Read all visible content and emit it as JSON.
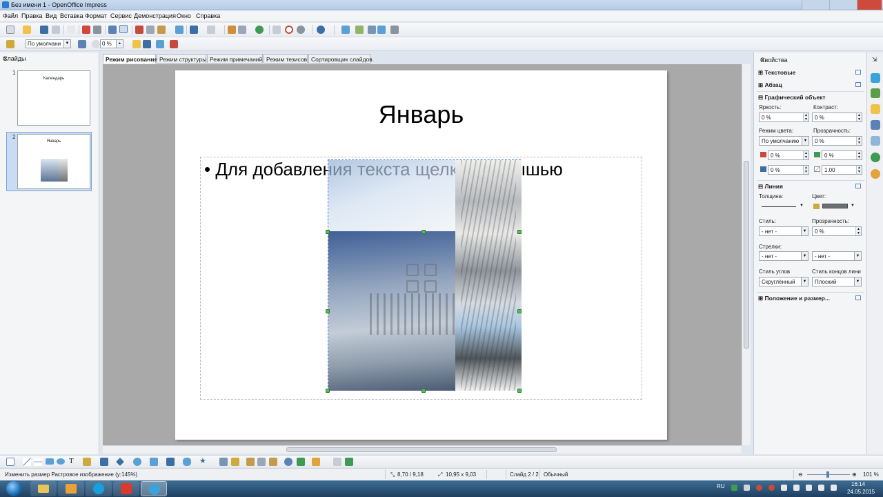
{
  "window": {
    "title": "Без имени 1 - OpenOffice Impress"
  },
  "menu": [
    "Файл",
    "Правка",
    "Вид",
    "Вставка",
    "Формат",
    "Сервис",
    "Демонстрация",
    "Окно",
    "Справка"
  ],
  "toolbar2": {
    "style_select": "По умолчани",
    "rotation_value": "0 %"
  },
  "slides_pane": {
    "title": "Слайды",
    "slides": [
      {
        "number": "1",
        "title": "Календарь"
      },
      {
        "number": "2",
        "title": "Январь"
      }
    ]
  },
  "view_tabs": [
    "Режим рисования",
    "Режим структуры",
    "Режим примечаний",
    "Режим тезисов",
    "Сортировщик слайдов"
  ],
  "slide": {
    "title": "Январь",
    "content_placeholder": "• Для добавления текста щелкните мышью"
  },
  "sidebar": {
    "title": "Свойства",
    "sections": {
      "text": "Текстовые",
      "paragraph": "Абзац",
      "graphic": "Графический объект",
      "line": "Линия",
      "position": "Положение и размер..."
    },
    "graphic": {
      "brightness_label": "Яркость:",
      "brightness": "0 %",
      "contrast_label": "Контраст:",
      "contrast": "0 %",
      "color_mode_label": "Режим цвета:",
      "color_mode": "По умолчанию",
      "transparency_label": "Прозрачность:",
      "transparency": "0 %",
      "red": "0 %",
      "green": "0 %",
      "blue": "0 %",
      "gamma": "1,00"
    },
    "line": {
      "width_label": "Толщина:",
      "color_label": "Цвет:",
      "style_label": "Стиль:",
      "style": "- нет -",
      "transparency_label": "Прозрачность:",
      "transparency": "0 %",
      "arrows_label": "Стрелки:",
      "arrow_start": "- нет -",
      "arrow_end": "- нет -",
      "corner_label": "Стиль углов",
      "corner": "Скруглённый",
      "cap_label": "Стиль концов лини",
      "cap": "Плоский"
    }
  },
  "status": {
    "message": "Изменить размер Растровое изображение (у:145%)",
    "position": "8,70 / 9,18",
    "size": "10,95 x 9,03",
    "slide": "Слайд 2 / 2",
    "layout": "Обычный",
    "zoom": "101 %"
  },
  "taskbar": {
    "lang": "RU",
    "time": "16:14",
    "date": "24.05.2015"
  },
  "colors": {
    "accent": "#3a6ea5",
    "handle": "#5cb85c",
    "canvas": "#a9a9a9"
  }
}
